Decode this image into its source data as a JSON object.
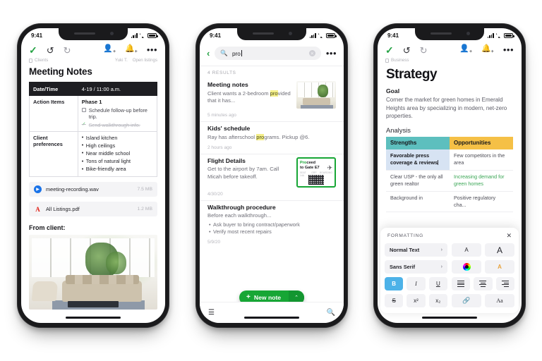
{
  "phones": {
    "one": {
      "status": {
        "time": "9:41"
      },
      "toolbar": {
        "confirm": "✓",
        "undo": "↺",
        "redo": "↻",
        "add_person": "person-add",
        "notify": "bell-add",
        "more": "•••"
      },
      "breadcrumb": "Clients",
      "tags": [
        "Yuki T.",
        "Open listings"
      ],
      "note_title": "Meeting Notes",
      "table": {
        "rows": [
          {
            "key": "Date/Time",
            "value": "4-19 / 11:00 a.m.",
            "dark": true
          },
          {
            "key": "Action Items",
            "phase": "Phase 1",
            "todos": [
              {
                "text": "Schedule follow-up before trip.",
                "done": false
              },
              {
                "text": "Send walkthrough info.",
                "done": true
              }
            ]
          },
          {
            "key": "Client preferences",
            "prefs": [
              {
                "text": "Island kitchen",
                "highlight": false
              },
              {
                "text": "High ceilings",
                "highlight": false
              },
              {
                "text": "Near middle school",
                "highlight": true
              },
              {
                "text": "Tons of natural light",
                "highlight": false
              },
              {
                "text": "Bike-friendly area",
                "highlight": false
              }
            ]
          }
        ]
      },
      "attachments": [
        {
          "name": "meeting-recording.wav",
          "size": "7.5 MB",
          "kind": "wav"
        },
        {
          "name": "All Listings.pdf",
          "size": "1.2 MB",
          "kind": "pdf"
        }
      ],
      "photo_label": "From client:"
    },
    "two": {
      "status": {
        "time": "9:41"
      },
      "search": {
        "query": "pro",
        "placeholder": "Search",
        "back": "‹",
        "clear": "✕",
        "more": "•••"
      },
      "results_count": "4 RESULTS",
      "results": [
        {
          "title": "Meeting notes",
          "snippet_pre": "Client wants a 2-bedroom ",
          "hit": "pro",
          "snippet_post": "vided that it has...",
          "time": "5 minutes ago",
          "thumb": "living-room"
        },
        {
          "title": "Kids' schedule",
          "snippet_pre": "Ray has afterschool ",
          "hit": "pro",
          "snippet_post": "grams. Pickup @6.",
          "time": "2 hours ago",
          "thumb": "none"
        },
        {
          "title": "Flight Details",
          "snippet_pre": "Get to the airport by 7am. Call Micah before takeoff.",
          "hit": "",
          "snippet_post": "",
          "time": "4/30/20",
          "thumb": "boarding-pass",
          "pass": {
            "line1_green": "Pro",
            "line1_rest": "ceed",
            "line2": "to Gate E7"
          }
        },
        {
          "title_pre": "Walkthrough ",
          "title_hit": "pro",
          "title_post": "cedure",
          "snippet_pre": "Before each walkthrough...",
          "hit": "",
          "snippet_post": "",
          "bullets": [
            "Ask buyer to bring contract/paperwork",
            "Verify most recent repairs"
          ],
          "time": "5/9/20",
          "thumb": "none"
        }
      ],
      "fab": {
        "label": "New note",
        "plus": "+",
        "caret": "⌃"
      },
      "tabbar": {
        "menu": "☰",
        "search": "search-icon"
      }
    },
    "three": {
      "status": {
        "time": "9:41"
      },
      "toolbar": {
        "confirm": "✓",
        "undo": "↺",
        "redo": "↻",
        "more": "•••"
      },
      "breadcrumb": "Business",
      "title": "Strategy",
      "goal_heading": "Goal",
      "goal_text": "Corner the market for green homes in Emerald Heights area by specializing in modern, net-zero properties.",
      "analysis_heading": "Analysis",
      "swot": {
        "headers": [
          "Strengths",
          "Opportunities"
        ],
        "header_colors": [
          "#5dbfbe",
          "#f5c046"
        ],
        "rows": [
          {
            "strength": "Favorable press coverage & reviews",
            "strength_selected": true,
            "opportunity": "Few competitors in the area",
            "opportunity_green": false
          },
          {
            "strength": "Clear USP - the only all green realtor",
            "strength_selected": false,
            "opportunity": "Increasing demand for green homes",
            "opportunity_green": true
          },
          {
            "strength": "Background in",
            "strength_selected": false,
            "opportunity": "Positive regulatory cha...",
            "opportunity_green": false
          }
        ]
      },
      "formatting": {
        "title": "FORMATTING",
        "close": "✕",
        "style_label": "Normal Text",
        "font_label": "Sans Serif",
        "chevron": "›",
        "buttons": {
          "font_small": "A",
          "font_large": "A",
          "color_swatch": "color-wheel",
          "highlight": "A",
          "bold": "B",
          "italic": "I",
          "underline": "U",
          "align_left": "align-left",
          "align_center": "align-center",
          "align_right": "align-right",
          "strikethrough": "S",
          "superscript": "x²",
          "subscript": "x₂",
          "link": "🔗",
          "clear_format": "Aa"
        },
        "active": "bold",
        "active_color": "#4db2e8"
      }
    }
  }
}
